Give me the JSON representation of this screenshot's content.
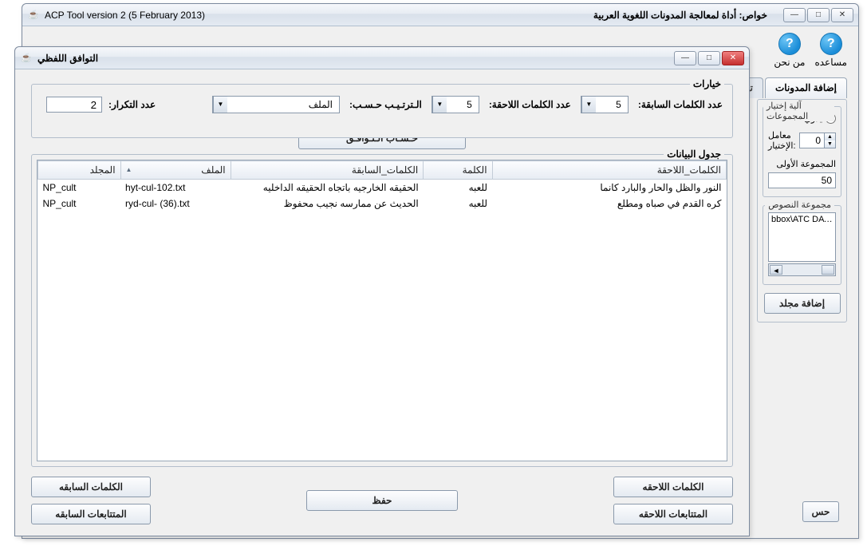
{
  "main_window": {
    "title_left": "ACP Tool version 2 (5 February 2013)",
    "title_right": "خواص: أداة لمعالجة المدونات اللغوية العربية",
    "help_about": "من نحن",
    "help_help": "مساعده",
    "tabs": {
      "truncate": "تنقي",
      "add_corpora": "إضافة المدونات"
    },
    "group_mech_legend": "آلية إختيار المجموعات",
    "manual": "يدوي",
    "coef_label": "معامل الإختيار:",
    "coef_value": "0",
    "first_group": "المجموعة الأولى",
    "first_group_val": "50",
    "text_set_legend": "مجموعة النصوص",
    "text_set_item": "bbox\\ATC DATA SET\\N",
    "add_folder": "إضافة مجلد",
    "bottom_partial": "حس"
  },
  "modal": {
    "title": "التوافق اللفظي",
    "options_legend": "خيارات",
    "prev_words_label": "عدد الكلمات السابقة:",
    "prev_words_val": "5",
    "next_words_label": "عدد الكلمات اللاحقة:",
    "next_words_val": "5",
    "sort_label": "الـترتـيـب حـسـب:",
    "sort_val": "الملف",
    "repeat_label": "عدد التكرار:",
    "repeat_val": "2",
    "calc_btn": "حـسـاب الـتـوافـق",
    "data_legend": "جدول البيانات",
    "columns": {
      "folder": "المجلد",
      "file": "الملف",
      "prev": "الكلمات_السابقة",
      "word": "الكلمة",
      "next": "الكلمات_اللاحقة"
    },
    "rows": [
      {
        "folder": "NP_cult",
        "file": "hyt-cul-102.txt",
        "prev": "الحقيقه الخارجيه باتجاه الحقيقه الداخليه",
        "word": "للعبه",
        "next": "النور والظل والحار والبارد كانما"
      },
      {
        "folder": "NP_cult",
        "file": "ryd-cul- (36).txt",
        "prev": "الحديث عن ممارسه نجيب محفوظ",
        "word": "للعبه",
        "next": "كره القدم في صباه ومطلع"
      }
    ],
    "buttons": {
      "prev_words": "الكلمات السابقه",
      "prev_collocates": "المتتابعات السابقه",
      "save": "حفظ",
      "next_words": "الكلمات اللاحقه",
      "next_collocates": "المتتابعات اللاحقه"
    }
  }
}
